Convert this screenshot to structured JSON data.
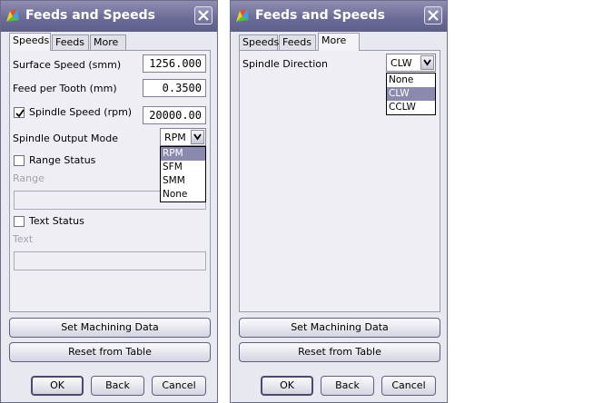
{
  "dialogs": [
    {
      "title": "Feeds and Speeds",
      "tabs": [
        "Speeds",
        "Feeds",
        "More"
      ],
      "active_tab": "Speeds",
      "fields": {
        "surface_speed": {
          "label": "Surface Speed (smm)",
          "value": "1256.000"
        },
        "feed_per_tooth": {
          "label": "Feed per Tooth (mm)",
          "value": "0.3500"
        },
        "spindle_speed": {
          "label": "Spindle Speed (rpm)",
          "value": "20000.00",
          "checked": true
        },
        "spindle_output_mode": {
          "label": "Spindle Output Mode",
          "value": "RPM",
          "options": [
            "RPM",
            "SFM",
            "SMM",
            "None"
          ],
          "highlighted": "RPM"
        },
        "range_status": {
          "label": "Range Status",
          "checked": false
        },
        "range": {
          "label": "Range",
          "value": ""
        },
        "text_status": {
          "label": "Text Status",
          "checked": false
        },
        "text": {
          "label": "Text",
          "value": ""
        }
      },
      "buttons": {
        "set_machining_data": "Set Machining Data",
        "reset_from_table": "Reset from Table",
        "ok": "OK",
        "back": "Back",
        "cancel": "Cancel"
      }
    },
    {
      "title": "Feeds and Speeds",
      "tabs": [
        "Speeds",
        "Feeds",
        "More"
      ],
      "active_tab": "More",
      "fields": {
        "spindle_direction": {
          "label": "Spindle Direction",
          "value": "CLW",
          "options": [
            "None",
            "CLW",
            "CCLW"
          ],
          "highlighted": "CLW"
        }
      },
      "buttons": {
        "set_machining_data": "Set Machining Data",
        "reset_from_table": "Reset from Table",
        "ok": "OK",
        "back": "Back",
        "cancel": "Cancel"
      }
    }
  ],
  "colors": {
    "titlebar": "#6c6c98",
    "dialog_bg": "#e8e8f0",
    "selection": "#8a8aaf"
  },
  "icons": [
    "app-icon",
    "close-icon",
    "checkmark-icon",
    "chevron-down-icon"
  ]
}
